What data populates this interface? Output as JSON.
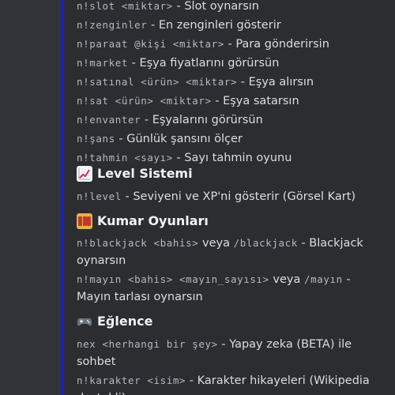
{
  "commands_top": [
    {
      "cmd": "n!slot <miktar>",
      "desc": " - Slot oynarsın"
    },
    {
      "cmd": "n!zenginler",
      "desc": " - En zenginleri gösterir"
    },
    {
      "cmd": "n!paraat @kişi <miktar>",
      "desc": " - Para gönderirsin"
    },
    {
      "cmd": "n!market",
      "desc": " - Eşya fiyatlarını görürsün"
    },
    {
      "cmd": "n!satınal <ürün> <miktar>",
      "desc": " - Eşya alırsın"
    },
    {
      "cmd": "n!sat <ürün> <miktar>",
      "desc": " - Eşya satarsın"
    },
    {
      "cmd": "n!envanter",
      "desc": " - Eşyalarını görürsün"
    },
    {
      "cmd": "n!şans",
      "desc": " - Günlük şansını ölçer"
    },
    {
      "cmd": "n!tahmin <sayı>",
      "desc": " - Sayı tahmin oyunu"
    }
  ],
  "level": {
    "icon": "chart-increasing-icon",
    "title": "Level Sistemi",
    "cmd": "n!level",
    "desc": " - Seviyeni ve XP'ni gösterir (Görsel Kart)"
  },
  "kumar": {
    "icon": "slot-machine-icon",
    "title": "Kumar Oyunları",
    "blackjack": {
      "cmd": "n!blackjack <bahis>",
      "mid": " veya ",
      "cmd2": "/blackjack",
      "desc": " - Blackjack oynarsın"
    },
    "mayin": {
      "cmd": "n!mayın <bahis> <mayın_sayısı>",
      "mid": " veya ",
      "cmd2": "/mayın",
      "desc": " - Mayın tarlası oynarsın"
    }
  },
  "eglence": {
    "icon": "game-controller-icon",
    "title": "Eğlence",
    "nex": {
      "cmd": "nex <herhangi bir şey>",
      "desc": " - Yapay zeka (BETA) ile sohbet"
    },
    "karakter": {
      "cmd": "n!karakter <isim>",
      "desc": " - Karakter hikayeleri (Wikipedia destekli)"
    }
  },
  "colors": {
    "background": "#313338",
    "embed": "#2b2d31",
    "accent": "#1a1ad6",
    "text": "#dbdee1",
    "code": "#b5bac1"
  }
}
